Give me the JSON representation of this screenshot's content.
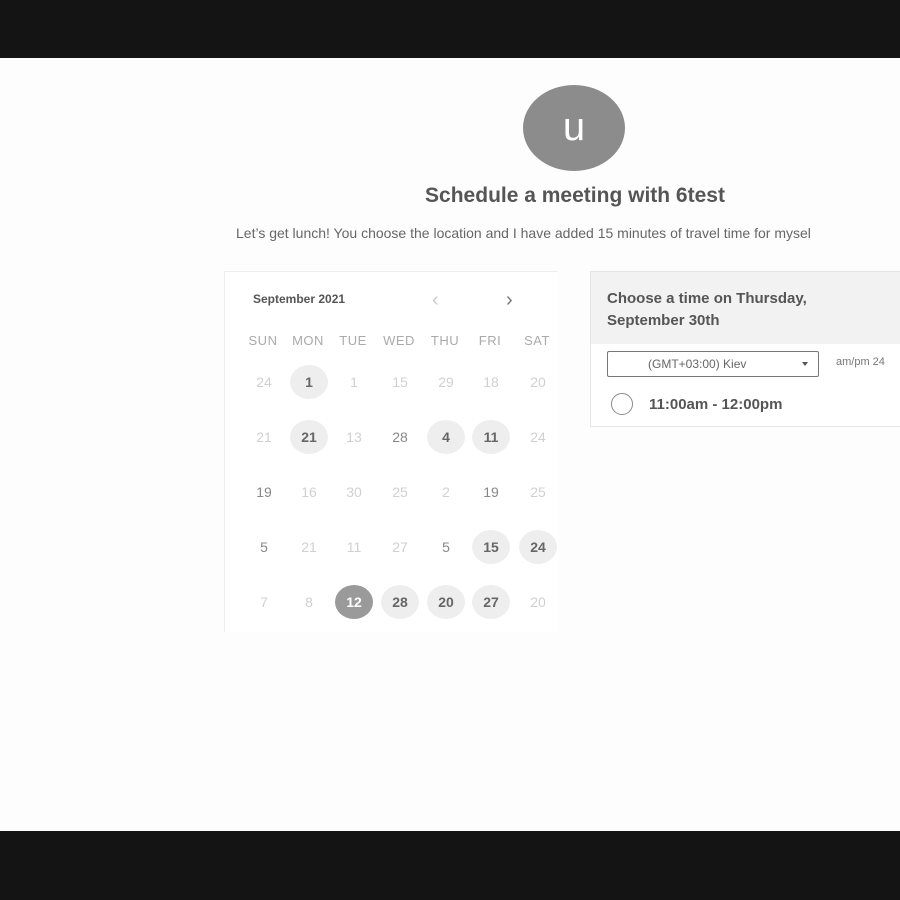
{
  "header": {
    "avatar_letter": "u",
    "title": "Schedule a meeting with 6test",
    "description": "Let’s get lunch! You choose the location and I have added 15 minutes of travel time for mysel"
  },
  "calendar": {
    "month_label": "September 2021",
    "prev_icon": "chevron-left-icon",
    "next_icon": "chevron-right-icon",
    "weekdays": [
      "SUN",
      "MON",
      "TUE",
      "WED",
      "THU",
      "FRI",
      "SAT"
    ],
    "weeks": [
      [
        {
          "label": "24",
          "state": "disabled"
        },
        {
          "label": "1",
          "state": "available"
        },
        {
          "label": "1",
          "state": "disabled"
        },
        {
          "label": "15",
          "state": "disabled"
        },
        {
          "label": "29",
          "state": "disabled"
        },
        {
          "label": "18",
          "state": "disabled"
        },
        {
          "label": "20",
          "state": "disabled"
        }
      ],
      [
        {
          "label": "21",
          "state": "disabled"
        },
        {
          "label": "21",
          "state": "available"
        },
        {
          "label": "13",
          "state": "disabled"
        },
        {
          "label": "28",
          "state": "plain"
        },
        {
          "label": "4",
          "state": "available"
        },
        {
          "label": "11",
          "state": "available"
        },
        {
          "label": "24",
          "state": "disabled"
        }
      ],
      [
        {
          "label": "19",
          "state": "plain"
        },
        {
          "label": "16",
          "state": "disabled"
        },
        {
          "label": "30",
          "state": "disabled"
        },
        {
          "label": "25",
          "state": "disabled"
        },
        {
          "label": "2",
          "state": "disabled"
        },
        {
          "label": "19",
          "state": "plain"
        },
        {
          "label": "25",
          "state": "disabled"
        }
      ],
      [
        {
          "label": "5",
          "state": "plain"
        },
        {
          "label": "21",
          "state": "disabled"
        },
        {
          "label": "11",
          "state": "disabled"
        },
        {
          "label": "27",
          "state": "disabled"
        },
        {
          "label": "5",
          "state": "plain"
        },
        {
          "label": "15",
          "state": "available"
        },
        {
          "label": "24",
          "state": "available"
        }
      ],
      [
        {
          "label": "7",
          "state": "disabled"
        },
        {
          "label": "8",
          "state": "disabled"
        },
        {
          "label": "12",
          "state": "selected"
        },
        {
          "label": "28",
          "state": "available"
        },
        {
          "label": "20",
          "state": "available"
        },
        {
          "label": "27",
          "state": "available"
        },
        {
          "label": "20",
          "state": "disabled"
        }
      ]
    ]
  },
  "time_panel": {
    "heading_line1": "Choose a time on Thursday,",
    "heading_line2": "September 30th",
    "timezone_value": "(GMT+03:00) Kiev",
    "format_toggle": "am/pm  24",
    "slots": [
      {
        "label": "11:00am - 12:00pm",
        "selected": false
      }
    ]
  },
  "colors": {
    "frame": "#141414",
    "page_bg": "#fdfdfd",
    "avatar_bg": "#8c8c8c",
    "available_day_bg": "#eeeeee",
    "selected_day_bg": "#9a9a9a"
  }
}
